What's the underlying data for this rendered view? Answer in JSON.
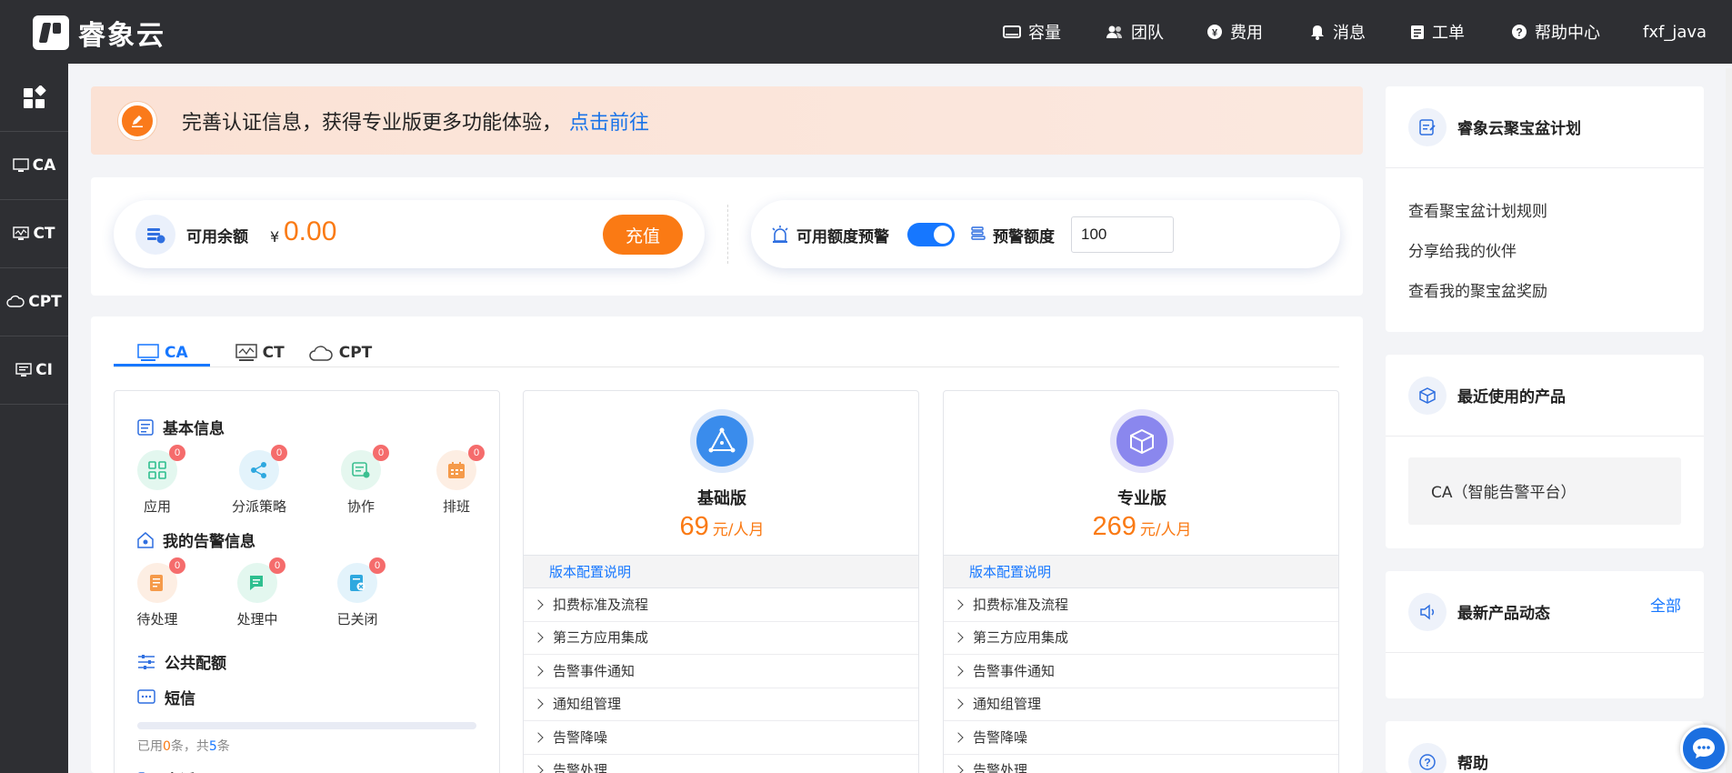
{
  "brand": {
    "name": "睿象云"
  },
  "topnav": [
    {
      "label": "容量",
      "icon": "capacity-icon"
    },
    {
      "label": "团队",
      "icon": "team-icon"
    },
    {
      "label": "费用",
      "icon": "cost-icon"
    },
    {
      "label": "消息",
      "icon": "bell-icon"
    },
    {
      "label": "工单",
      "icon": "ticket-icon"
    },
    {
      "label": "帮助中心",
      "icon": "help-icon"
    },
    {
      "label": "fxf_java"
    }
  ],
  "sidebar": {
    "items": [
      {
        "label": "",
        "icon": "apps-grid-icon"
      },
      {
        "label": "CA",
        "icon": "ca-icon"
      },
      {
        "label": "CT",
        "icon": "ct-icon"
      },
      {
        "label": "CPT",
        "icon": "cpt-cloud-icon"
      },
      {
        "label": "CI",
        "icon": "ci-icon"
      }
    ]
  },
  "banner": {
    "text": "完善认证信息，获得专业版更多功能体验，",
    "link": "点击前往"
  },
  "balance": {
    "label": "可用余额",
    "currency": "¥",
    "amount": "0.00",
    "recharge": "充值"
  },
  "alert_quota": {
    "label": "可用额度预警",
    "enabled": true,
    "threshold_label": "预警额度",
    "threshold_value": "100"
  },
  "product_tabs": [
    {
      "label": "CA",
      "active": true
    },
    {
      "label": "CT"
    },
    {
      "label": "CPT"
    }
  ],
  "basic_info": {
    "title": "基本信息",
    "items": [
      {
        "label": "应用",
        "count": "0",
        "color": "#e3f7ef",
        "icon_color": "#2fbf8f"
      },
      {
        "label": "分派策略",
        "count": "0",
        "color": "#e3f3fb",
        "icon_color": "#2ea8df"
      },
      {
        "label": "协作",
        "count": "0",
        "color": "#e5f7ef",
        "icon_color": "#3bbf90"
      },
      {
        "label": "排班",
        "count": "0",
        "color": "#fdeee3",
        "icon_color": "#f59a4a"
      }
    ]
  },
  "my_alerts": {
    "title": "我的告警信息",
    "items": [
      {
        "label": "待处理",
        "count": "0",
        "color": "#fdeee3",
        "icon_color": "#f59a4a"
      },
      {
        "label": "处理中",
        "count": "0",
        "color": "#e3f7ef",
        "icon_color": "#2fbf8f"
      },
      {
        "label": "已关闭",
        "count": "0",
        "color": "#e3f3fb",
        "icon_color": "#2ea8df"
      }
    ]
  },
  "public_quota": {
    "title": "公共配额",
    "sms_title": "短信",
    "sms_used_prefix": "已用",
    "sms_used": "0",
    "sms_mid": "条，共",
    "sms_total": "5",
    "sms_suffix": "条",
    "sms_progress": 0,
    "voice_title": "电话"
  },
  "plans": [
    {
      "name": "基础版",
      "price": "69",
      "unit": "元/人月",
      "config_title": "版本配置说明",
      "rows": [
        "扣费标准及流程",
        "第三方应用集成",
        "告警事件通知",
        "通知组管理",
        "告警降噪",
        "告警处理"
      ]
    },
    {
      "name": "专业版",
      "price": "269",
      "unit": "元/人月",
      "config_title": "版本配置说明",
      "rows": [
        "扣费标准及流程",
        "第三方应用集成",
        "告警事件通知",
        "通知组管理",
        "告警降噪",
        "告警处理"
      ]
    }
  ],
  "right": {
    "treasure": {
      "title": "睿象云聚宝盆计划",
      "links": [
        "查看聚宝盆计划规则",
        "分享给我的伙伴",
        "查看我的聚宝盆奖励"
      ]
    },
    "recent": {
      "title": "最近使用的产品",
      "item": "CA（智能告警平台）"
    },
    "news": {
      "title": "最新产品动态",
      "all": "全部"
    },
    "help": {
      "title": "帮助"
    }
  },
  "colors": {
    "accent": "#1677ff",
    "orange": "#fa7a14",
    "topbar": "#2e2f33"
  }
}
